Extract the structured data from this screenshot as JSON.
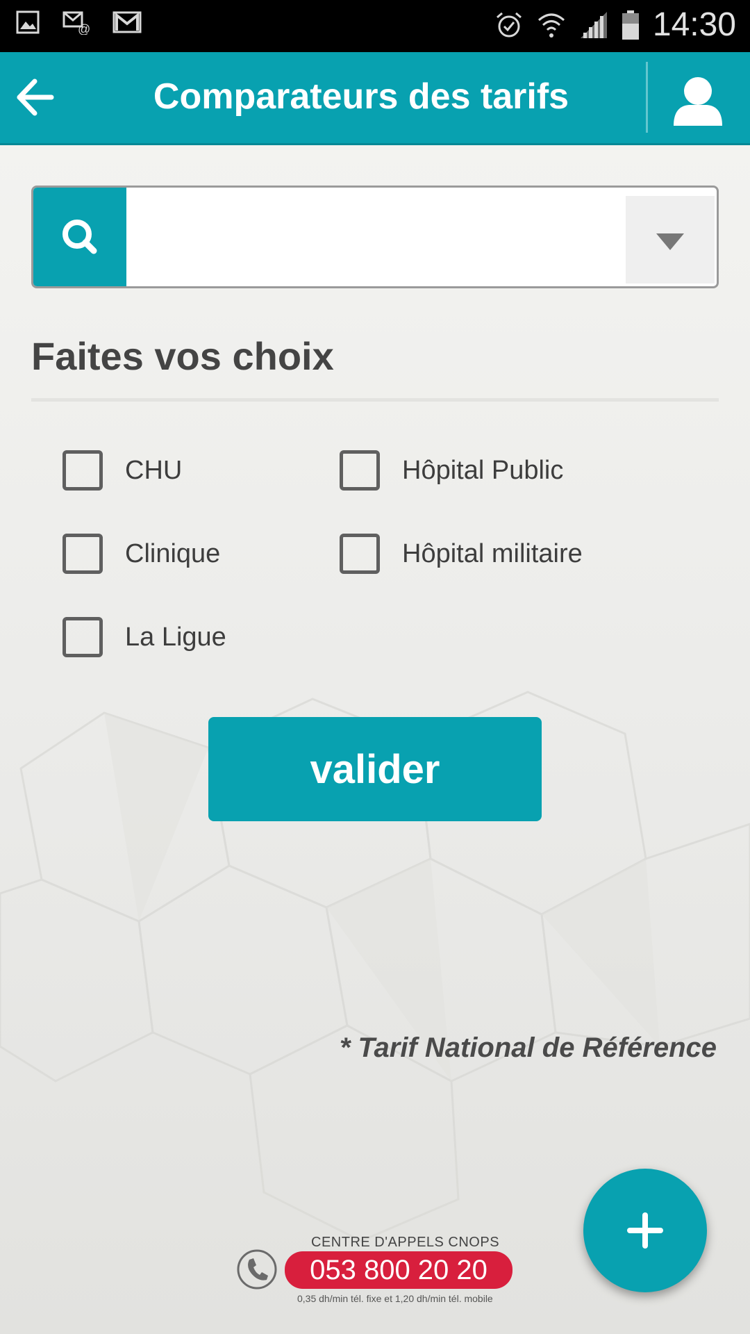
{
  "status_bar": {
    "time": "14:30",
    "icons": [
      "gallery-icon",
      "mail-at-icon",
      "gmail-icon",
      "alarm-icon",
      "wifi-icon",
      "signal-icon",
      "battery-icon"
    ]
  },
  "app_bar": {
    "title": "Comparateurs des tarifs",
    "back_icon": "arrow-left-icon",
    "profile_icon": "user-icon",
    "color": "#08a1b0"
  },
  "search": {
    "value": "",
    "placeholder": "",
    "icon": "search-icon",
    "dropdown_icon": "triangle-down-icon"
  },
  "choices": {
    "title": "Faites vos choix",
    "options": [
      {
        "label": "CHU",
        "checked": false
      },
      {
        "label": "Hôpital Public",
        "checked": false
      },
      {
        "label": "Clinique",
        "checked": false
      },
      {
        "label": "Hôpital militaire",
        "checked": false
      },
      {
        "label": "La Ligue",
        "checked": false
      }
    ]
  },
  "validate_button": "valider",
  "note": "* Tarif National de Référence",
  "call_center": {
    "title": "CENTRE D'APPELS CNOPS",
    "number": "053 800 20 20",
    "rates": "0,35 dh/min tél. fixe et 1,20 dh/min tél. mobile",
    "accent": "#d81f3d"
  },
  "fab": {
    "icon": "plus-icon"
  }
}
